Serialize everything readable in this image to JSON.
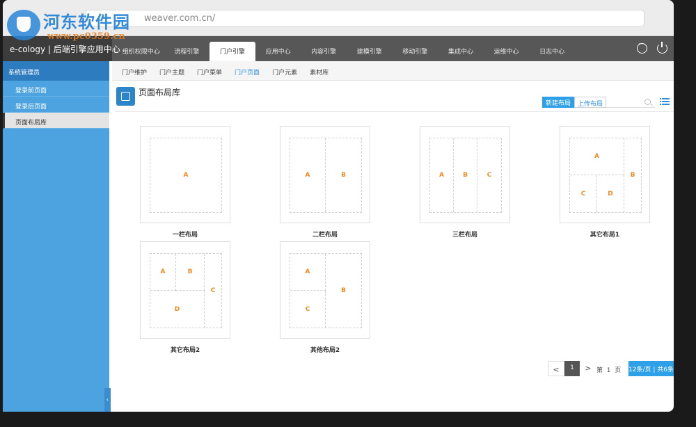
{
  "browser": {
    "url": "weaver.com.cn/"
  },
  "watermark": {
    "title": "河东软件园",
    "url": "www.pc0359.cn"
  },
  "topnav": {
    "brand": "e-cology | 后端引擎应用中心",
    "tabs": [
      "组织权限中心",
      "流程引擎",
      "门户引擎",
      "应用中心",
      "内容引擎",
      "建模引擎",
      "移动引擎",
      "集成中心",
      "运维中心",
      "日志中心"
    ],
    "active_tab": "门户引擎"
  },
  "sidebar": {
    "header": "系统管理员",
    "items": [
      "登录前页面",
      "登录后页面",
      "页面布局库"
    ],
    "active_item": "页面布局库"
  },
  "subnav": {
    "tabs": [
      "门户维护",
      "门户主题",
      "门户菜单",
      "门户页面",
      "门户元素",
      "素材库"
    ],
    "active_tab": "门户页面"
  },
  "page": {
    "title": "页面布局库"
  },
  "toolbar": {
    "new_label": "新建布局",
    "upload_label": "上传布局",
    "search_placeholder": ""
  },
  "layouts": [
    {
      "name": "一栏布局",
      "cells": [
        "A"
      ]
    },
    {
      "name": "二栏布局",
      "cells": [
        "A",
        "B"
      ]
    },
    {
      "name": "三栏布局",
      "cells": [
        "A",
        "B",
        "C"
      ]
    },
    {
      "name": "其它布局1",
      "cells": [
        "A",
        "B",
        "C",
        "D"
      ]
    },
    {
      "name": "其它布局2",
      "cells": [
        "A",
        "B",
        "C",
        "D"
      ]
    },
    {
      "name": "其他布局2",
      "cells": [
        "A",
        "B",
        "C"
      ]
    }
  ],
  "pagination": {
    "prev": "<",
    "current": "1",
    "next": ">",
    "info_prefix": "第",
    "info_page": "1",
    "info_suffix": "页",
    "page_size": "12条/页 | 共6条"
  },
  "colors": {
    "accent": "#2ea0e8",
    "sidebar": "#4da3e0",
    "cell_label": "#f08a24",
    "topnav": "#575757"
  }
}
